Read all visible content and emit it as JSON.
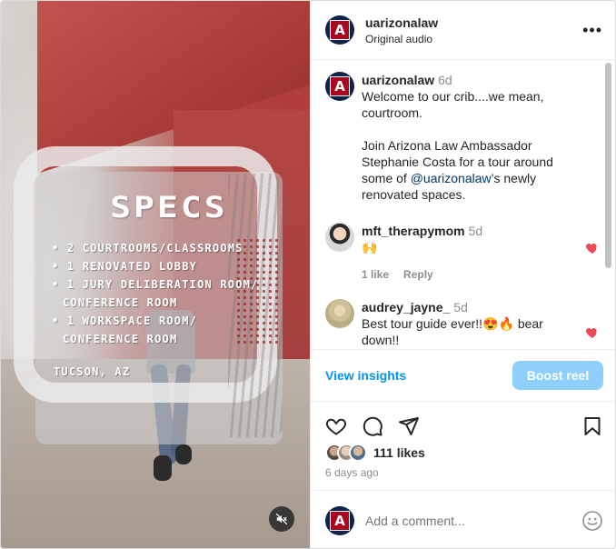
{
  "media": {
    "title": "SPECS",
    "specs": [
      "• 2 courtrooms/classrooms",
      "• 1 renovated lobby",
      "• 1 jury deliberation room/",
      "conference room",
      "• 1 workspace room/",
      "conference room"
    ],
    "location": "Tucson, AZ",
    "mute_icon": "speaker-muted-icon"
  },
  "header": {
    "username": "uarizonalaw",
    "audio": "Original audio",
    "more_icon": "more-horizontal-icon",
    "more_label": "•••"
  },
  "caption": {
    "username": "uarizonalaw",
    "time": "6d",
    "line1": "Welcome to our crib....we mean, courtroom.",
    "line2_pre": "Join Arizona Law Ambassador Stephanie Costa for a tour around some of ",
    "line2_link": "@uarizonalaw",
    "line2_post": "’s newly renovated spaces."
  },
  "comments": [
    {
      "username": "mft_therapymom",
      "time": "5d",
      "text": "🙌",
      "likes": "1 like",
      "reply": "Reply",
      "liked": true
    },
    {
      "username": "audrey_jayne_",
      "time": "5d",
      "text": "Best tour guide ever!!😍🔥 bear down!!",
      "liked": true
    }
  ],
  "insights": {
    "view_label": "View insights",
    "boost_label": "Boost reel"
  },
  "post": {
    "likes": "111 likes",
    "date": "6 days ago"
  },
  "add_comment": {
    "placeholder": "Add a comment..."
  },
  "colors": {
    "accent_blue": "#0095f6",
    "boost_disabled": "#8ed0fb",
    "heart_red": "#ed4956",
    "arizona_navy": "#0c234b",
    "arizona_red": "#ab0520"
  }
}
